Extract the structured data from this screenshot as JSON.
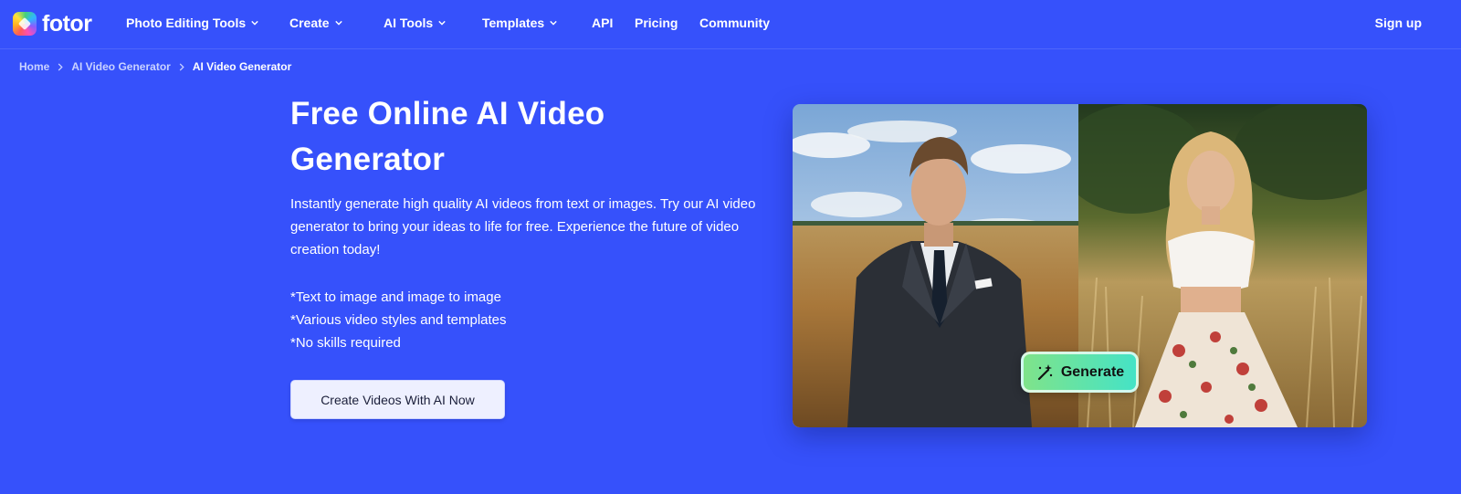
{
  "brand": {
    "name": "fotor"
  },
  "nav": {
    "items": [
      {
        "label": "Photo Editing Tools",
        "dropdown": true
      },
      {
        "label": "Create",
        "dropdown": true
      },
      {
        "label": "AI Tools",
        "dropdown": true
      },
      {
        "label": "Templates",
        "dropdown": true
      },
      {
        "label": "API",
        "dropdown": false
      },
      {
        "label": "Pricing",
        "dropdown": false
      },
      {
        "label": "Community",
        "dropdown": false
      }
    ],
    "signup_label": "Sign up"
  },
  "breadcrumb": [
    {
      "label": "Home"
    },
    {
      "label": "AI Video Generator"
    },
    {
      "label": "AI Video Generator"
    }
  ],
  "hero": {
    "title_line1": "Free Online AI Video",
    "title_line2": "Generator",
    "description": "Instantly generate high quality AI videos from text or images. Try our AI video generator to bring your ideas to life for free. Experience the future of video creation today!",
    "features": [
      "*Text to image and image to image",
      "*Various video styles and templates",
      "*No skills required"
    ],
    "cta_label": "Create Videos With AI Now"
  },
  "preview": {
    "generate_label": "Generate",
    "icon": "magic-wand-icon"
  },
  "colors": {
    "background": "#3651fb",
    "cta_bg": "#eef0ff",
    "generate_gradient_start": "#7fe38a",
    "generate_gradient_end": "#45e3c6"
  }
}
